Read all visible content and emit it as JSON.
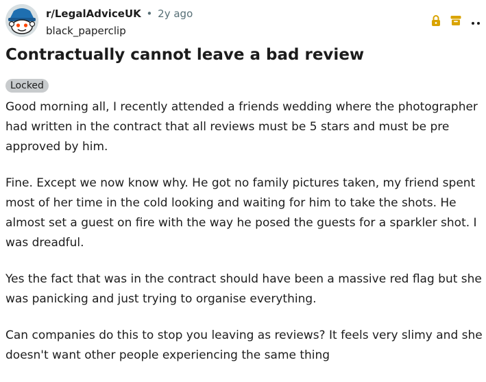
{
  "post": {
    "subreddit": "r/LegalAdviceUK",
    "separator": "•",
    "age": "2y ago",
    "author": "black_paperclip",
    "title": "Contractually cannot leave a bad review",
    "flair": "Locked",
    "paragraphs": [
      "Good morning all, I recently attended a friends wedding where the photographer had written in the contract that all reviews must be 5 stars and must be pre approved by him.",
      "Fine. Except we now know why. He got no family pictures taken, my friend spent most of her time in the cold looking and waiting for him to take the shots. He almost set a guest on fire with the way he posed the guests for a sparkler shot. I was dreadful.",
      "Yes the fact that was in the contract should have been a massive red flag but she was panicking and just trying to organise everything.",
      "Can companies do this to stop you leaving as reviews? It feels very slimy and she doesn't want other people experiencing the same thing"
    ]
  },
  "icons": {
    "avatar": "snoo-avatar-icon",
    "lock": "lock-icon",
    "archive": "archive-icon",
    "more": "more-options-icon"
  },
  "colors": {
    "status_icons": "#d9a300",
    "flair_bg": "#c8cbcd",
    "meta_text": "#576f76"
  }
}
